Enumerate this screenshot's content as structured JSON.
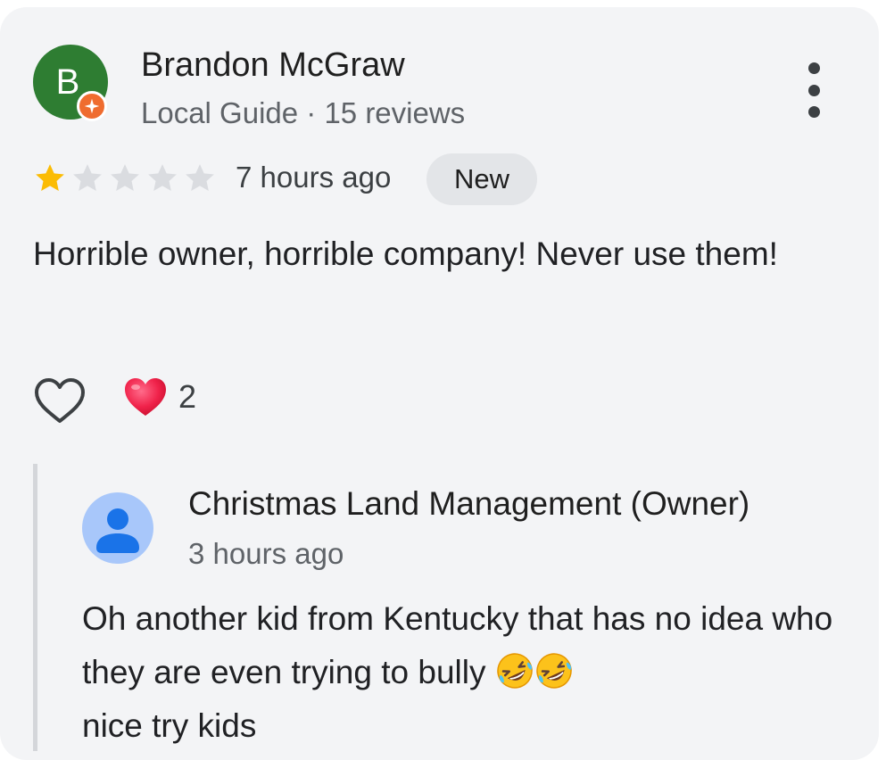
{
  "review": {
    "author": {
      "avatar_initial": "B",
      "name": "Brandon McGraw",
      "meta": "Local Guide · 15 reviews",
      "avatar_color": "#2e7d32",
      "badge_color": "#ef6c2f"
    },
    "rating": 1,
    "max_rating": 5,
    "time_ago": "7 hours ago",
    "badge": "New",
    "text": "Horrible owner, horrible company! Never use them!",
    "reactions": {
      "like_icon": "heart-outline-icon",
      "reaction_icon": "red-heart-emoji",
      "count": "2"
    },
    "icons": {
      "more": "more-vert-icon",
      "star_filled_color": "#fbbc04",
      "star_empty_color": "#dadce0"
    }
  },
  "owner_reply": {
    "name": "Christmas Land Management (Owner)",
    "time_ago": "3 hours ago",
    "text": "Oh another kid from Kentucky that has no idea who they are even trying to bully",
    "text_end": "nice try kids",
    "emojis": [
      "rolling-on-floor-laughing-emoji",
      "rolling-on-floor-laughing-emoji"
    ],
    "avatar_color": "#a8c7fa"
  }
}
